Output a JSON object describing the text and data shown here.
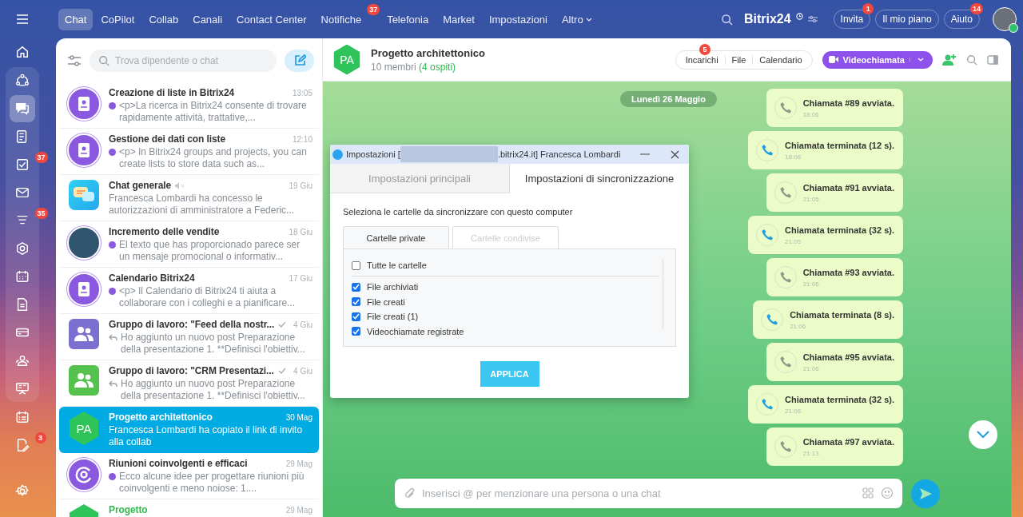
{
  "rail": {
    "top_items": [
      {
        "kind": "home",
        "selected": false
      }
    ],
    "pinned_items": [
      {
        "kind": "flow",
        "selected": false
      },
      {
        "kind": "chat",
        "selected": true
      },
      {
        "kind": "feed",
        "selected": false
      },
      {
        "kind": "tasks",
        "selected": false,
        "badge": "37"
      },
      {
        "kind": "mail",
        "selected": false
      },
      {
        "kind": "funnel",
        "selected": false,
        "badge": "35"
      },
      {
        "kind": "hexagon",
        "selected": false
      },
      {
        "kind": "calendar",
        "selected": false
      },
      {
        "kind": "doc",
        "selected": false
      },
      {
        "kind": "card",
        "selected": false
      },
      {
        "kind": "people",
        "selected": false
      },
      {
        "kind": "board",
        "selected": false
      }
    ],
    "more_items": [
      {
        "kind": "schedule",
        "selected": false
      },
      {
        "kind": "edit",
        "selected": false,
        "badge": "3"
      }
    ]
  },
  "nav": {
    "tabs": [
      {
        "label": "Chat",
        "selected": true,
        "kind": "link"
      },
      {
        "label": "CoPilot",
        "selected": false,
        "kind": "link"
      },
      {
        "label": "Collab",
        "selected": false,
        "kind": "link"
      },
      {
        "label": "Canali",
        "selected": false,
        "kind": "link"
      },
      {
        "label": "Contact Center",
        "selected": false,
        "kind": "link"
      },
      {
        "label": "Notifiche",
        "selected": false,
        "kind": "link",
        "badge": "37"
      },
      {
        "label": "Telefonia",
        "selected": false,
        "kind": "link"
      },
      {
        "label": "Market",
        "selected": false,
        "kind": "link"
      },
      {
        "label": "Impostazioni",
        "selected": false,
        "kind": "link"
      },
      {
        "label": "Altro",
        "selected": false,
        "kind": "menu"
      }
    ],
    "logo": "Bitrix24",
    "buttons": [
      {
        "label": "Invita",
        "badge": "1"
      },
      {
        "label": "Il mio piano"
      },
      {
        "label": "Aiuto",
        "badge": "14"
      }
    ]
  },
  "chat_list": {
    "search_placeholder": "Trova dipendente o chat",
    "items": [
      {
        "title": "Creazione di liste in Bitrix24",
        "time": "13:05",
        "preview": {
          "kind": "avatar",
          "text": "<p>La ricerca in Bitrix24 consente di trovare rapidamente attività, trattative,..."
        },
        "avatar": {
          "kind": "book"
        },
        "muted": false,
        "delivered": false,
        "selected": false
      },
      {
        "title": "Gestione dei dati con liste",
        "time": "12:10",
        "preview": {
          "kind": "avatar",
          "text": "<p> In Bitrix24 groups and projects, you can create lists to store data such as..."
        },
        "avatar": {
          "kind": "book"
        },
        "muted": false,
        "delivered": false,
        "selected": false
      },
      {
        "title": "Chat generale",
        "time": "19 Giu",
        "preview": {
          "kind": "plain",
          "text": "Francesca Lombardi ha concesso le autorizzazioni di amministratore a Federic..."
        },
        "avatar": {
          "kind": "bubbles"
        },
        "muted": true,
        "delivered": false,
        "selected": false
      },
      {
        "title": "Incremento delle vendite",
        "time": "18 Giu",
        "preview": {
          "kind": "avatar",
          "text": "El texto que has proporcionado parece ser un mensaje promocional o informativ..."
        },
        "avatar": {
          "kind": "photo"
        },
        "muted": false,
        "delivered": false,
        "selected": false
      },
      {
        "title": "Calendario Bitrix24",
        "time": "17 Giu",
        "preview": {
          "kind": "avatar",
          "text": "<p> Il Calendario di Bitrix24 ti aiuta a collaborare con i colleghi e a pianificare..."
        },
        "avatar": {
          "kind": "book"
        },
        "muted": false,
        "delivered": false,
        "selected": false
      },
      {
        "title": "Gruppo di lavoro: \"Feed della nostr...",
        "time": "4 Giu",
        "preview": {
          "kind": "reply",
          "text": "Ho aggiunto un nuovo post Preparazione della presentazione 1. **Definisci l'obiettiv..."
        },
        "avatar": {
          "kind": "group",
          "color": "#7b6fcf"
        },
        "muted": false,
        "delivered": true,
        "selected": false
      },
      {
        "title": "Gruppo di lavoro: \"CRM Presentazi...",
        "time": "4 Giu",
        "preview": {
          "kind": "reply",
          "text": "Ho aggiunto un nuovo post Preparazione della presentazione 1. **Definisci l'obiettiv..."
        },
        "avatar": {
          "kind": "group",
          "color": "#55c24e"
        },
        "muted": false,
        "delivered": true,
        "selected": false
      },
      {
        "title": "Progetto architettonico",
        "time": "30 Mag",
        "preview": {
          "kind": "plain",
          "text": "Francesca Lombardi ha copiato il link di invito alla collab"
        },
        "avatar": {
          "kind": "hexagon",
          "initials": "PA"
        },
        "muted": false,
        "delivered": false,
        "selected": true
      },
      {
        "title": "Riunioni coinvolgenti e efficaci",
        "time": "29 Mag",
        "preview": {
          "kind": "avatar",
          "text": "Ecco alcune idee per progettare riunioni più coinvolgenti e meno noiose: 1...."
        },
        "avatar": {
          "kind": "swirl"
        },
        "muted": false,
        "delivered": false,
        "selected": false
      },
      {
        "title": "Progetto",
        "time": "29 Mag",
        "avatar": {
          "kind": "hexagon"
        },
        "muted": false,
        "delivered": false,
        "selected": false
      }
    ]
  },
  "chat_header": {
    "initials": "PA",
    "title": "Progetto architettonico",
    "members": "10 membri",
    "guests": "(4 ospiti)",
    "tabs": [
      {
        "label": "Incarichi",
        "badge": "5"
      },
      {
        "label": "File"
      },
      {
        "label": "Calendario"
      }
    ],
    "call_button": "Videochiamata"
  },
  "date_pill": "Lunedì 26 Maggio",
  "messages": [
    {
      "kind": "started",
      "text": "Chiamata #89 avviata.",
      "time": "18:06"
    },
    {
      "kind": "ended",
      "text": "Chiamata terminata (12 s).",
      "time": "18:06"
    },
    {
      "kind": "started",
      "text": "Chiamata #91 avviata.",
      "time": "21:05"
    },
    {
      "kind": "ended",
      "text": "Chiamata terminata (32 s).",
      "time": "21:05"
    },
    {
      "kind": "started",
      "text": "Chiamata #93 avviata.",
      "time": "21:06"
    },
    {
      "kind": "ended",
      "text": "Chiamata terminata (8 s).",
      "time": "21:06"
    },
    {
      "kind": "started",
      "text": "Chiamata #95 avviata.",
      "time": "21:06"
    },
    {
      "kind": "ended",
      "text": "Chiamata terminata (32 s).",
      "time": "21:06"
    },
    {
      "kind": "started",
      "text": "Chiamata #97 avviata.",
      "time": "21:13"
    }
  ],
  "composer": {
    "placeholder": "Inserisci @ per menzionare una persona o una chat"
  },
  "dialog": {
    "title_prefix": "Impostazioni [",
    "title_suffix": ".bitrix24.it] Francesca Lombardi",
    "tabs": [
      {
        "label": "Impostazioni principali",
        "selected": false
      },
      {
        "label": "Impostazioni di sincronizzazione",
        "selected": true
      }
    ],
    "instruction": "Seleziona le cartelle da sincronizzare con questo computer",
    "folder_tabs": [
      {
        "label": "Cartelle private",
        "selected": true
      },
      {
        "label": "Cartelle condivise",
        "selected": false
      }
    ],
    "select_all": {
      "label": "Tutte le cartelle",
      "checked": false
    },
    "folders": [
      {
        "label": "File archiviati",
        "checked": true
      },
      {
        "label": "File creati",
        "checked": true
      },
      {
        "label": "File creati (1)",
        "checked": true
      },
      {
        "label": "Videochiamate registrate",
        "checked": true
      }
    ],
    "apply_button": "APPLICA"
  }
}
